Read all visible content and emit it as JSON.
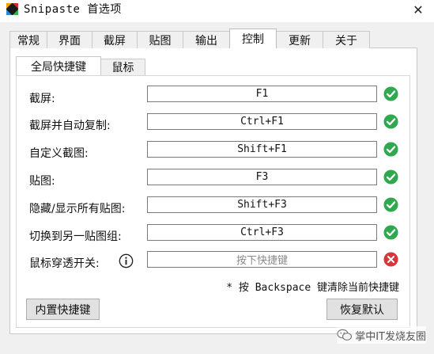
{
  "window": {
    "title": "Snipaste 首选项",
    "close_glyph": "✕"
  },
  "tabs": [
    {
      "label": "常规",
      "active": false
    },
    {
      "label": "界面",
      "active": false
    },
    {
      "label": "截屏",
      "active": false
    },
    {
      "label": "贴图",
      "active": false
    },
    {
      "label": "输出",
      "active": false
    },
    {
      "label": "控制",
      "active": true
    },
    {
      "label": "更新",
      "active": false
    },
    {
      "label": "关于",
      "active": false
    }
  ],
  "subtabs": [
    {
      "label": "全局快捷键",
      "active": true
    },
    {
      "label": "鼠标",
      "active": false
    }
  ],
  "hotkeys": [
    {
      "label": "截屏:",
      "value": "F1",
      "placeholder": "",
      "status": "ok",
      "status_icon": "check-icon"
    },
    {
      "label": "截屏并自动复制:",
      "value": "Ctrl+F1",
      "placeholder": "",
      "status": "ok",
      "status_icon": "check-icon"
    },
    {
      "label": "自定义截图:",
      "value": "Shift+F1",
      "placeholder": "",
      "status": "ok",
      "status_icon": "check-icon"
    },
    {
      "label": "贴图:",
      "value": "F3",
      "placeholder": "",
      "status": "ok",
      "status_icon": "check-icon"
    },
    {
      "label": "隐藏/显示所有贴图:",
      "value": "Shift+F3",
      "placeholder": "",
      "status": "ok",
      "status_icon": "check-icon"
    },
    {
      "label": "切换到另一贴图组:",
      "value": "Ctrl+F3",
      "placeholder": "",
      "status": "ok",
      "status_icon": "check-icon"
    },
    {
      "label": "鼠标穿透开关:",
      "value": "",
      "placeholder": "按下快捷键",
      "status": "error",
      "status_icon": "error-icon"
    }
  ],
  "hint": "* 按 Backspace 键清除当前快捷键",
  "buttons": {
    "builtin": "内置快捷键",
    "restore": "恢复默认"
  },
  "watermark": "掌中IT发烧友圈",
  "colors": {
    "ok": "#2fa84f",
    "error": "#d9353a",
    "panel": "#ffffff",
    "chrome": "#f0f0f0"
  }
}
